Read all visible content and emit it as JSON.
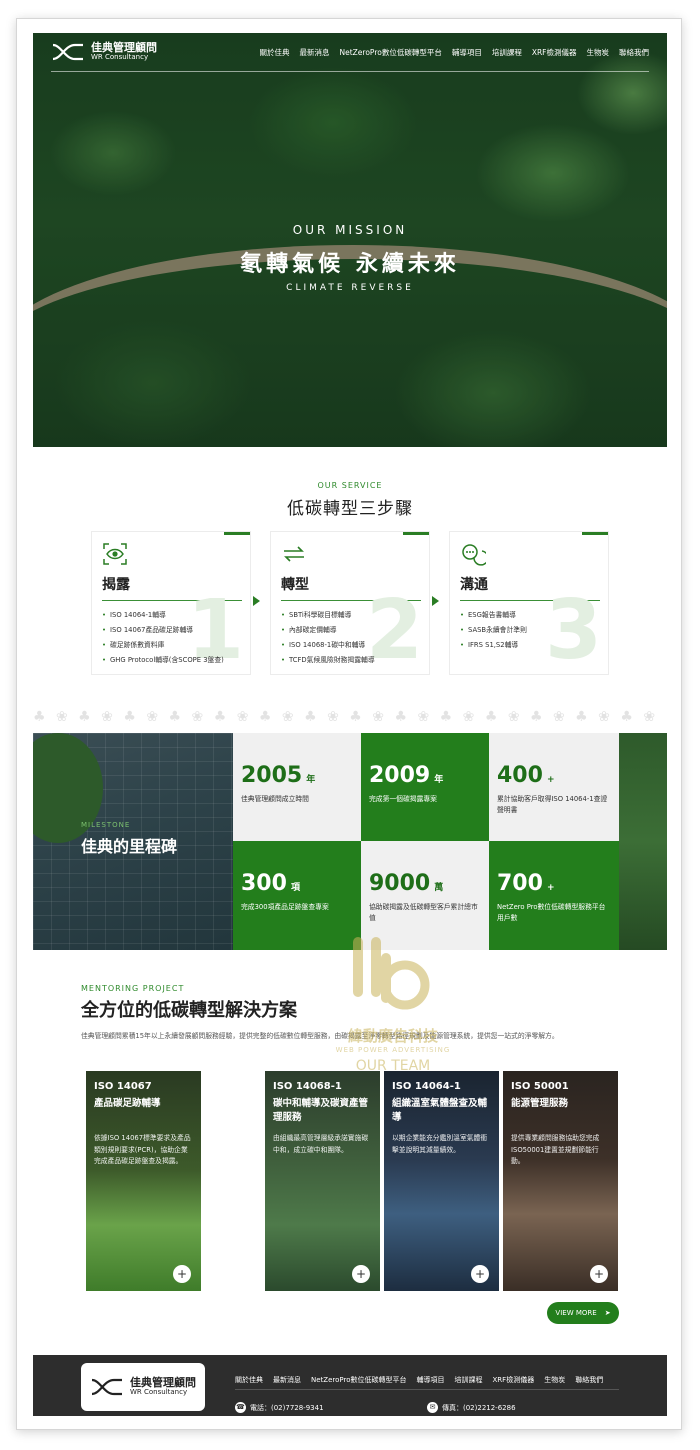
{
  "brand": {
    "name_cn": "佳典管理顧問",
    "name_en": "WR Consultancy"
  },
  "nav": {
    "items": [
      "關於佳典",
      "最新消息",
      "NetZeroPro數位低碳轉型平台",
      "輔導項目",
      "培訓課程",
      "XRF檢測儀器",
      "生物炭",
      "聯絡我們"
    ]
  },
  "hero": {
    "eyebrow": "OUR MISSION",
    "title": "氡轉氣候 永續未來",
    "subtitle": "CLIMATE REVERSE"
  },
  "service": {
    "label": "OUR SERVICE",
    "title": "低碳轉型三步驟",
    "cards": [
      {
        "icon": "eye-scan-icon",
        "title": "揭露",
        "number": "1",
        "items": [
          "ISO 14064-1輔導",
          "ISO 14067產品碳足跡輔導",
          "碳足跡係數資料庫",
          "GHG Protocol輔導(含SCOPE 3盤查)"
        ]
      },
      {
        "icon": "exchange-arrows-icon",
        "title": "轉型",
        "number": "2",
        "items": [
          "SBTi科學碳目標輔導",
          "內部碳定價輔導",
          "ISO 14068-1碳中和輔導",
          "TCFD氣候風險財務揭露輔導"
        ]
      },
      {
        "icon": "chat-bubbles-icon",
        "title": "溝通",
        "number": "3",
        "items": [
          "ESG報告書輔導",
          "SASB永續會計準則",
          "IFRS S1,S2輔導"
        ]
      }
    ]
  },
  "milestone": {
    "label": "MILESTONE",
    "title": "佳典的里程碑",
    "stats": [
      {
        "num": "2005",
        "unit": "年",
        "desc": "佳典管理顧問成立時間",
        "style": "grey"
      },
      {
        "num": "2009",
        "unit": "年",
        "desc": "完成第一個碳揭露專案",
        "style": "green"
      },
      {
        "num": "400",
        "unit": "+",
        "desc": "累計協助客戶取得ISO 14064-1查證聲明書",
        "style": "grey"
      },
      {
        "num": "300",
        "unit": "項",
        "desc": "完成300項產品足跡盤查專案",
        "style": "green"
      },
      {
        "num": "9000",
        "unit": "萬",
        "desc": "協助碳揭露及低碳轉型客戶累計總市值",
        "style": "grey"
      },
      {
        "num": "700",
        "unit": "+",
        "desc": "NetZero Pro數位低碳轉型服務平台用戶數",
        "style": "green"
      }
    ]
  },
  "mentoring": {
    "label": "MENTORING PROJECT",
    "title": "全方位的低碳轉型解決方案",
    "desc": "佳典管理顧問累積15年以上永續發展顧問服務經驗，提供完整的低碳數位轉型服務，由碳揭露至淨零轉型路徑規劃及能源管理系統，提供您一站式的淨零解方。",
    "cards": [
      {
        "code": "ISO 14067",
        "name": "產品碳足跡輔導",
        "desc": "依據ISO 14067標準要求及產品類別規則要求(PCR)，協助企業完成產品碳足跡盤查及揭露。"
      },
      {
        "code": "ISO 14068-1",
        "name": "碳中和輔導及碳資產管理服務",
        "desc": "由組織最高管理層級承諾實施碳中和，成立碳中和團隊。"
      },
      {
        "code": "ISO 14064-1",
        "name": "組織溫室氣體盤查及輔導",
        "desc": "以期企業能充分鑑別溫室氣體衝擊並說明其減量績效。"
      },
      {
        "code": "ISO 50001",
        "name": "能源管理服務",
        "desc": "提供專業顧問服務協助您完成ISO50001建置並規劃節能行動。"
      }
    ],
    "view_more": "VIEW MORE",
    "plus": "+"
  },
  "footer": {
    "menu": [
      "關於佳典",
      "最新消息",
      "NetZeroPro數位低碳轉型平台",
      "輔導項目",
      "培訓課程",
      "XRF檢測儀器",
      "生物炭",
      "聯絡我們"
    ],
    "phone": "電話：(02)7728-9341",
    "fax": "傳真：(02)2212-6286"
  },
  "watermark": {
    "cn": "緯動廣告科技",
    "en": "WEB POWER ADVERTISING",
    "team": "OUR TEAM"
  },
  "colors": {
    "primary_green": "#237e1c",
    "light_grey": "#f0f0f0",
    "footer_dark": "#2d2d2d"
  }
}
